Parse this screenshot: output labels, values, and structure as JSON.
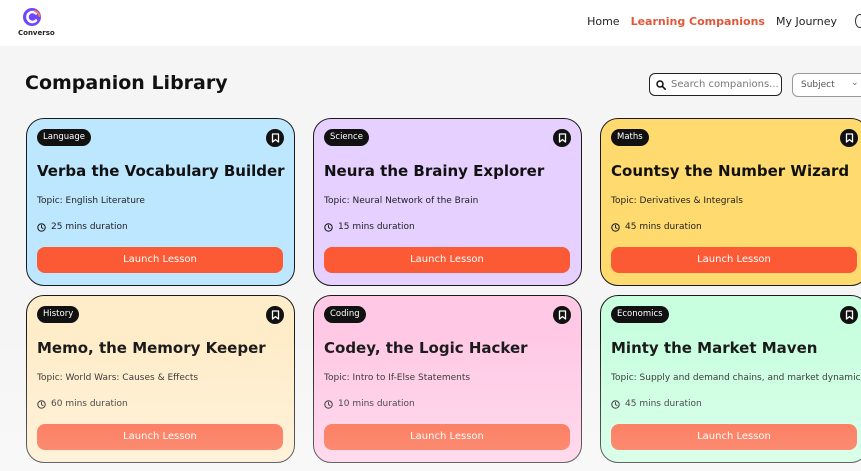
{
  "brand": {
    "name": "Converso",
    "color": "#6c47ff"
  },
  "nav": {
    "items": [
      {
        "label": "Home",
        "active": false
      },
      {
        "label": "Learning Companions",
        "active": true
      },
      {
        "label": "My Journey",
        "active": false
      }
    ],
    "active_color": "#e0583a"
  },
  "page": {
    "title": "Companion Library"
  },
  "search": {
    "placeholder": "Search companions..."
  },
  "filter": {
    "subject_label": "Subject"
  },
  "companions": [
    {
      "subject": "Language",
      "title": "Verba the Vocabulary Builder",
      "topic": "Topic: English Literature",
      "duration": "25 mins duration",
      "button": "Launch Lesson",
      "color": "#bde7ff",
      "bookmark_icon": "bookmark-icon"
    },
    {
      "subject": "Science",
      "title": "Neura the Brainy Explorer",
      "topic": "Topic: Neural Network of the Brain",
      "duration": "15 mins duration",
      "button": "Launch Lesson",
      "color": "#e5d0ff",
      "bookmark_icon": "bookmark-icon"
    },
    {
      "subject": "Maths",
      "title": "Countsy the Number Wizard",
      "topic": "Topic: Derivatives & Integrals",
      "duration": "45 mins duration",
      "button": "Launch Lesson",
      "color": "#ffda6e",
      "bookmark_icon": "bookmark-icon"
    },
    {
      "subject": "History",
      "title": "Memo, the Memory Keeper",
      "topic": "Topic: World Wars: Causes & Effects",
      "duration": "60 mins duration",
      "button": "Launch Lesson",
      "color": "#ffecc8",
      "bookmark_icon": "bookmark-icon"
    },
    {
      "subject": "Coding",
      "title": "Codey, the Logic Hacker",
      "topic": "Topic: Intro to If-Else Statements",
      "duration": "10 mins duration",
      "button": "Launch Lesson",
      "color": "#ffc8e4",
      "bookmark_icon": "bookmark-icon"
    },
    {
      "subject": "Economics",
      "title": "Minty the Market Maven",
      "topic": "Topic: Supply and demand chains, and market dynamics.",
      "duration": "45 mins duration",
      "button": "Launch Lesson",
      "color": "#c8ffdf",
      "bookmark_icon": "bookmark-icon"
    }
  ],
  "button_color": "#fb5a35"
}
